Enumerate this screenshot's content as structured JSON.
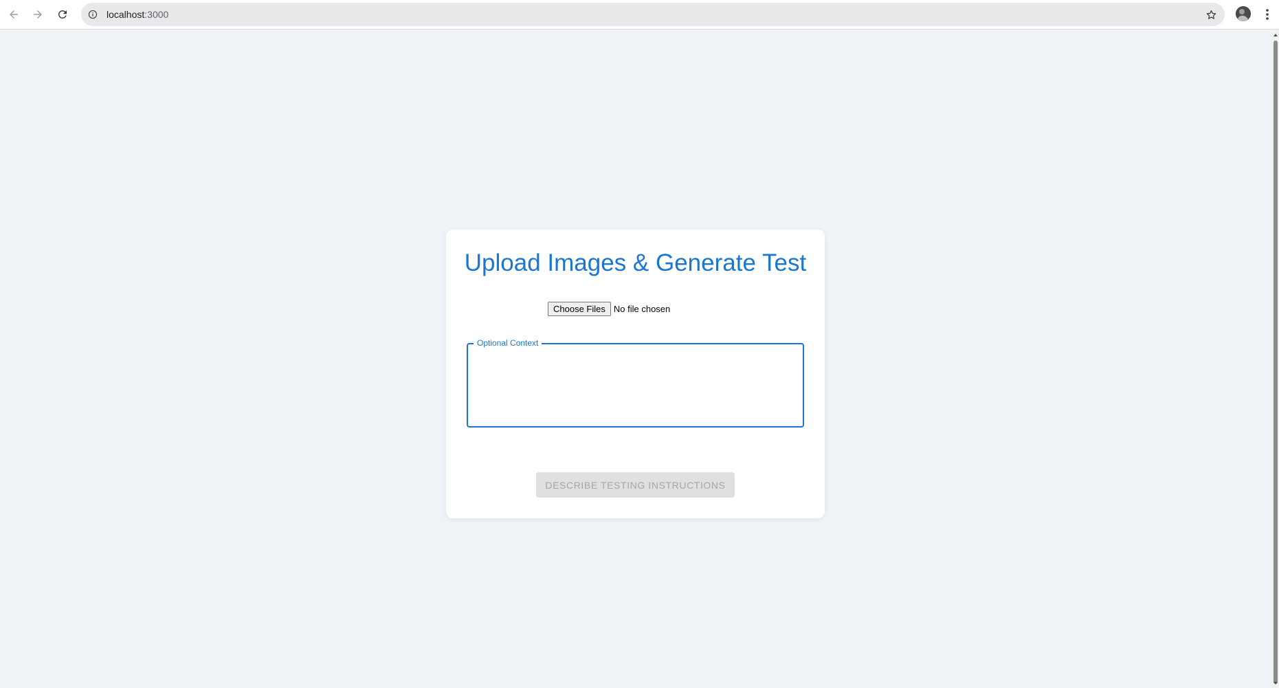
{
  "browser": {
    "url_host": "localhost",
    "url_port": ":3000",
    "icons": {
      "back": "arrow-left-icon",
      "forward": "arrow-right-icon",
      "reload": "reload-icon",
      "site_info": "info-icon",
      "bookmark": "star-icon",
      "profile": "avatar",
      "menu": "kebab-menu-icon"
    }
  },
  "card": {
    "title": "Upload Images & Generate Test",
    "file_button_label": "Choose Files",
    "file_status": "No file chosen",
    "context_label": "Optional Context",
    "context_value": "",
    "submit_label": "DESCRIBE TESTING INSTRUCTIONS"
  },
  "colors": {
    "accent": "#1976d2",
    "page_background": "#eff2f6",
    "disabled_button_bg": "#e0e0e0",
    "disabled_button_text": "#a6a6a6"
  }
}
